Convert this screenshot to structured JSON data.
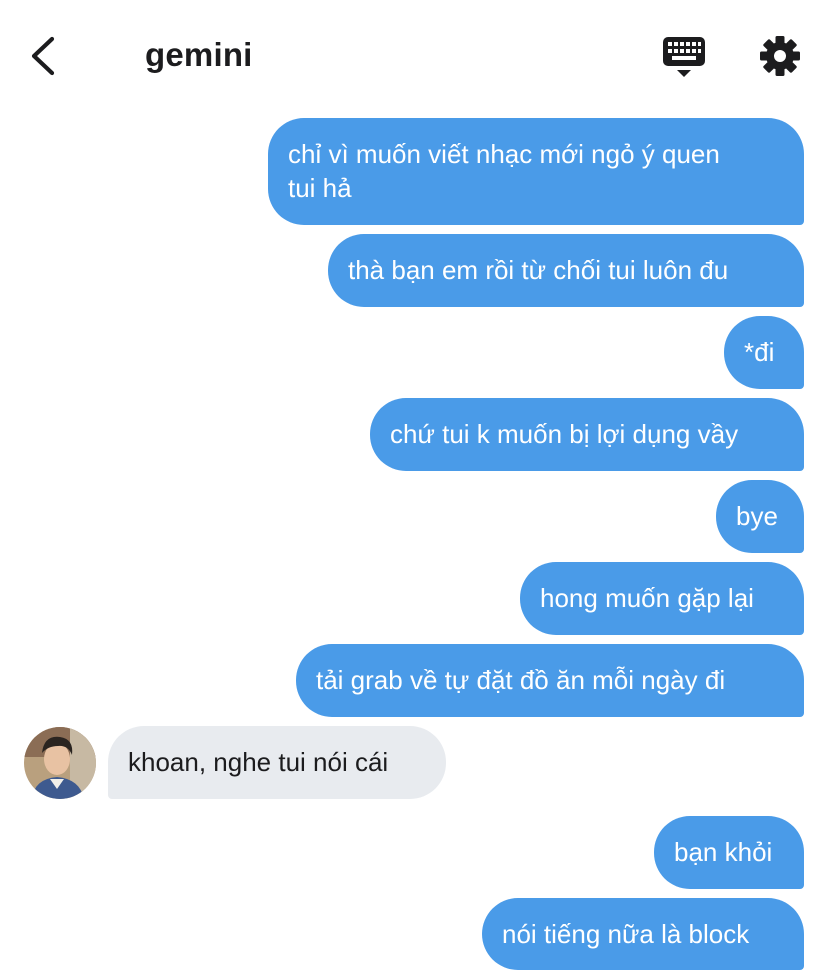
{
  "header": {
    "title": "gemini",
    "back_icon": "chevron-left-icon",
    "keyboard_icon": "keyboard-icon",
    "settings_icon": "gear-icon"
  },
  "colors": {
    "outgoing_bubble": "#4a9be8",
    "incoming_bubble": "#e8ebef"
  },
  "messages": [
    {
      "direction": "out",
      "text": "chỉ vì muốn viết nhạc mới ngỏ ý quen\ntui hả"
    },
    {
      "direction": "out",
      "text": "thà bạn em rồi từ chối tui luôn đu"
    },
    {
      "direction": "out",
      "text": "*đi"
    },
    {
      "direction": "out",
      "text": "chứ tui k muốn bị lợi dụng vầy"
    },
    {
      "direction": "out",
      "text": "bye"
    },
    {
      "direction": "out",
      "text": "hong muốn gặp lại"
    },
    {
      "direction": "out",
      "text": "tải grab về tự đặt đồ ăn mỗi ngày đi"
    },
    {
      "direction": "in",
      "text": "khoan, nghe tui nói cái"
    },
    {
      "direction": "out",
      "text": "bạn khỏi"
    },
    {
      "direction": "out",
      "text": "nói tiếng nữa là block"
    }
  ]
}
